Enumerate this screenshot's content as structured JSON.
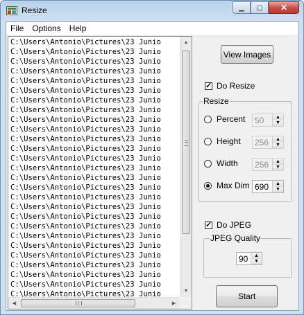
{
  "window": {
    "title": "Resize"
  },
  "menu": {
    "file": "File",
    "options": "Options",
    "help": "Help"
  },
  "list": {
    "lines": [
      "C:\\Users\\Antonio\\Pictures\\23 Junio",
      "C:\\Users\\Antonio\\Pictures\\23 Junio",
      "C:\\Users\\Antonio\\Pictures\\23 Junio",
      "C:\\Users\\Antonio\\Pictures\\23 Junio",
      "C:\\Users\\Antonio\\Pictures\\23 Junio",
      "C:\\Users\\Antonio\\Pictures\\23 Junio",
      "C:\\Users\\Antonio\\Pictures\\23 Junio",
      "C:\\Users\\Antonio\\Pictures\\23 Junio",
      "C:\\Users\\Antonio\\Pictures\\23 Junio",
      "C:\\Users\\Antonio\\Pictures\\23 Junio",
      "C:\\Users\\Antonio\\Pictures\\23 Junio",
      "C:\\Users\\Antonio\\Pictures\\23 Junio",
      "C:\\Users\\Antonio\\Pictures\\23 Junio",
      "C:\\Users\\Antonio\\Pictures\\23 Junio",
      "C:\\Users\\Antonio\\Pictures\\23 Junio",
      "C:\\Users\\Antonio\\Pictures\\23 Junio",
      "C:\\Users\\Antonio\\Pictures\\23 Junio",
      "C:\\Users\\Antonio\\Pictures\\23 Junio",
      "C:\\Users\\Antonio\\Pictures\\23 Junio",
      "C:\\Users\\Antonio\\Pictures\\23 Junio",
      "C:\\Users\\Antonio\\Pictures\\23 Junio",
      "C:\\Users\\Antonio\\Pictures\\23 Junio",
      "C:\\Users\\Antonio\\Pictures\\23 Junio",
      "C:\\Users\\Antonio\\Pictures\\23 Junio",
      "C:\\Users\\Antonio\\Pictures\\23 Junio",
      "C:\\Users\\Antonio\\Pictures\\23 Junio",
      "C:\\Users\\Antonio\\Pictures\\23 Junio"
    ]
  },
  "controls": {
    "view_images": "View Images",
    "do_resize": {
      "label": "Do Resize",
      "checked": true
    },
    "resize_group": "Resize",
    "resize_options": [
      {
        "label": "Percent",
        "value": "50",
        "selected": false
      },
      {
        "label": "Height",
        "value": "256",
        "selected": false
      },
      {
        "label": "Width",
        "value": "256",
        "selected": false
      },
      {
        "label": "Max Dim",
        "value": "690",
        "selected": true
      }
    ],
    "do_jpeg": {
      "label": "Do JPEG",
      "checked": true
    },
    "jpeg_group": "JPEG Quality",
    "jpeg_quality": "90",
    "start": "Start"
  }
}
